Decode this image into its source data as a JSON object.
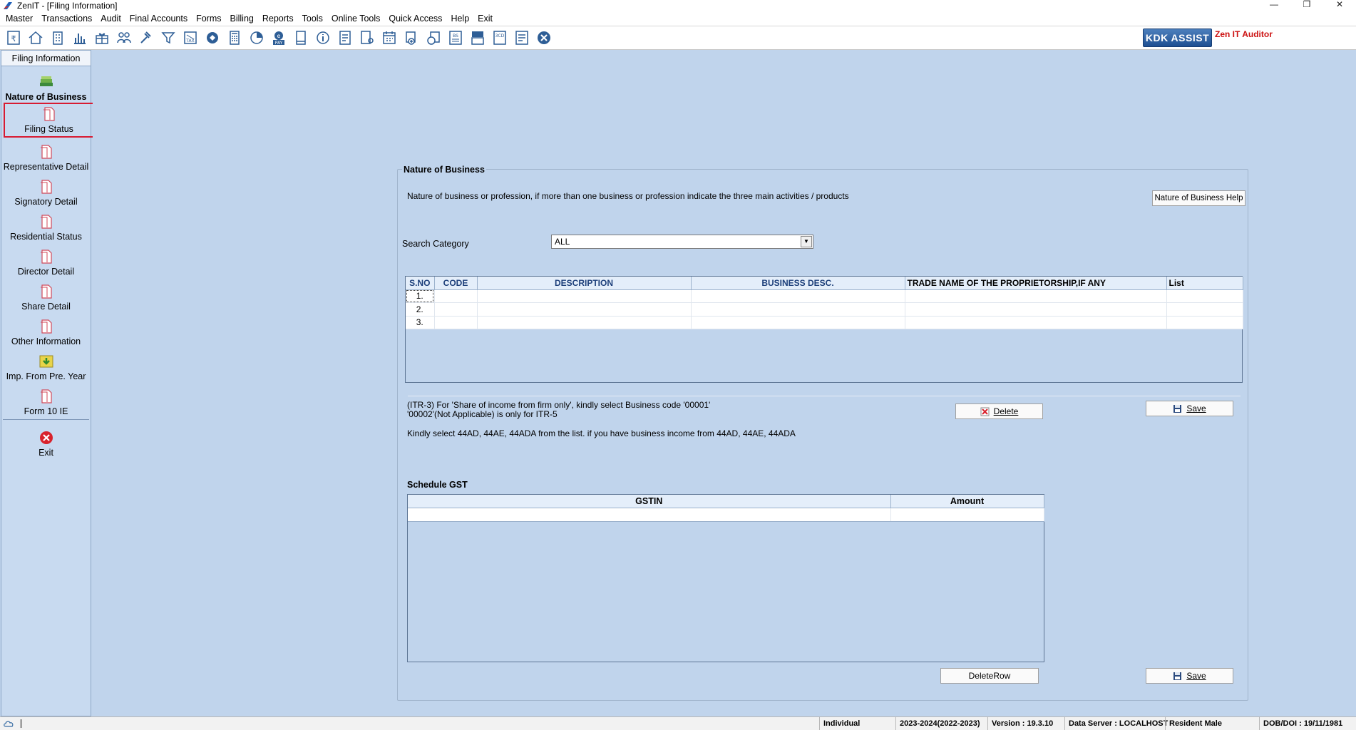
{
  "window": {
    "title": "ZenIT - [Filing Information]",
    "controls": [
      "—",
      "❐",
      "✕"
    ]
  },
  "menu": [
    "Master",
    "Transactions",
    "Audit",
    "Final Accounts",
    "Forms",
    "Billing",
    "Reports",
    "Tools",
    "Online Tools",
    "Quick Access",
    "Help",
    "Exit"
  ],
  "toolbar": {
    "icons": [
      "rupee-book-icon",
      "home-icon",
      "building-icon",
      "bar-chart-icon",
      "gift-icon",
      "people-icon",
      "gavel-icon",
      "filter-icon",
      "tax-icon",
      "disc-icon",
      "calculator-icon",
      "pie-icon",
      "pay-icon",
      "book-icon",
      "info-icon",
      "report-icon",
      "form-user-icon",
      "calendar-icon",
      "add-doc-icon",
      "refresh-doc-icon",
      "bs-icon",
      "tds-icon",
      "3cd-icon",
      "ledger-icon",
      "close-circle-icon"
    ],
    "kdk_label": "KDK ASSIST",
    "auditor_label": "Zen IT Auditor"
  },
  "sidebar": {
    "header": "Filing Information",
    "items": [
      {
        "label": "Nature of Business",
        "icon": "books-icon"
      },
      {
        "label": "Filing Status",
        "icon": "document-icon"
      },
      {
        "label": "Representative Detail",
        "icon": "document-icon"
      },
      {
        "label": "Signatory Detail",
        "icon": "document-icon"
      },
      {
        "label": "Residential Status",
        "icon": "document-icon"
      },
      {
        "label": "Director Detail",
        "icon": "document-icon"
      },
      {
        "label": "Share Detail",
        "icon": "document-icon"
      },
      {
        "label": "Other Information",
        "icon": "document-icon"
      },
      {
        "label": "Imp. From Pre. Year",
        "icon": "import-icon"
      },
      {
        "label": "Form 10 IE",
        "icon": "document-icon"
      }
    ],
    "exit_label": "Exit"
  },
  "nob": {
    "title": "Nature of Business",
    "description": "Nature of business or profession, if more than one business or profession indicate the three main activities / products",
    "help_button": "Nature of Business Help",
    "search_label": "Search Category",
    "search_value": "ALL",
    "columns": [
      "S.NO",
      "CODE",
      "DESCRIPTION",
      "BUSINESS DESC.",
      "TRADE NAME OF THE PROPRIETORSHIP,IF ANY",
      "List"
    ],
    "rows": [
      {
        "sno": "1."
      },
      {
        "sno": "2."
      },
      {
        "sno": "3."
      }
    ],
    "note_line1": "(ITR-3) For 'Share of income from firm only', kindly select Business code '00001'",
    "note_line2": "'00002'(Not Applicable) is only for ITR-5",
    "note_line3": "Kindly select 44AD, 44AE, 44ADA from the list. if you have business income from 44AD, 44AE, 44ADA",
    "delete_button": "Delete",
    "save_button": "Save"
  },
  "gst": {
    "title": "Schedule GST",
    "columns": [
      "GSTIN",
      "Amount"
    ],
    "deleterow_button": "DeleteRow",
    "save_button": "Save"
  },
  "status": {
    "type": "Individual",
    "year": "2023-2024(2022-2023)",
    "version": "Version : 19.3.10",
    "server": "Data Server : LOCALHOST",
    "residency": "Resident Male",
    "dob": "DOB/DOI : 19/11/1981"
  }
}
